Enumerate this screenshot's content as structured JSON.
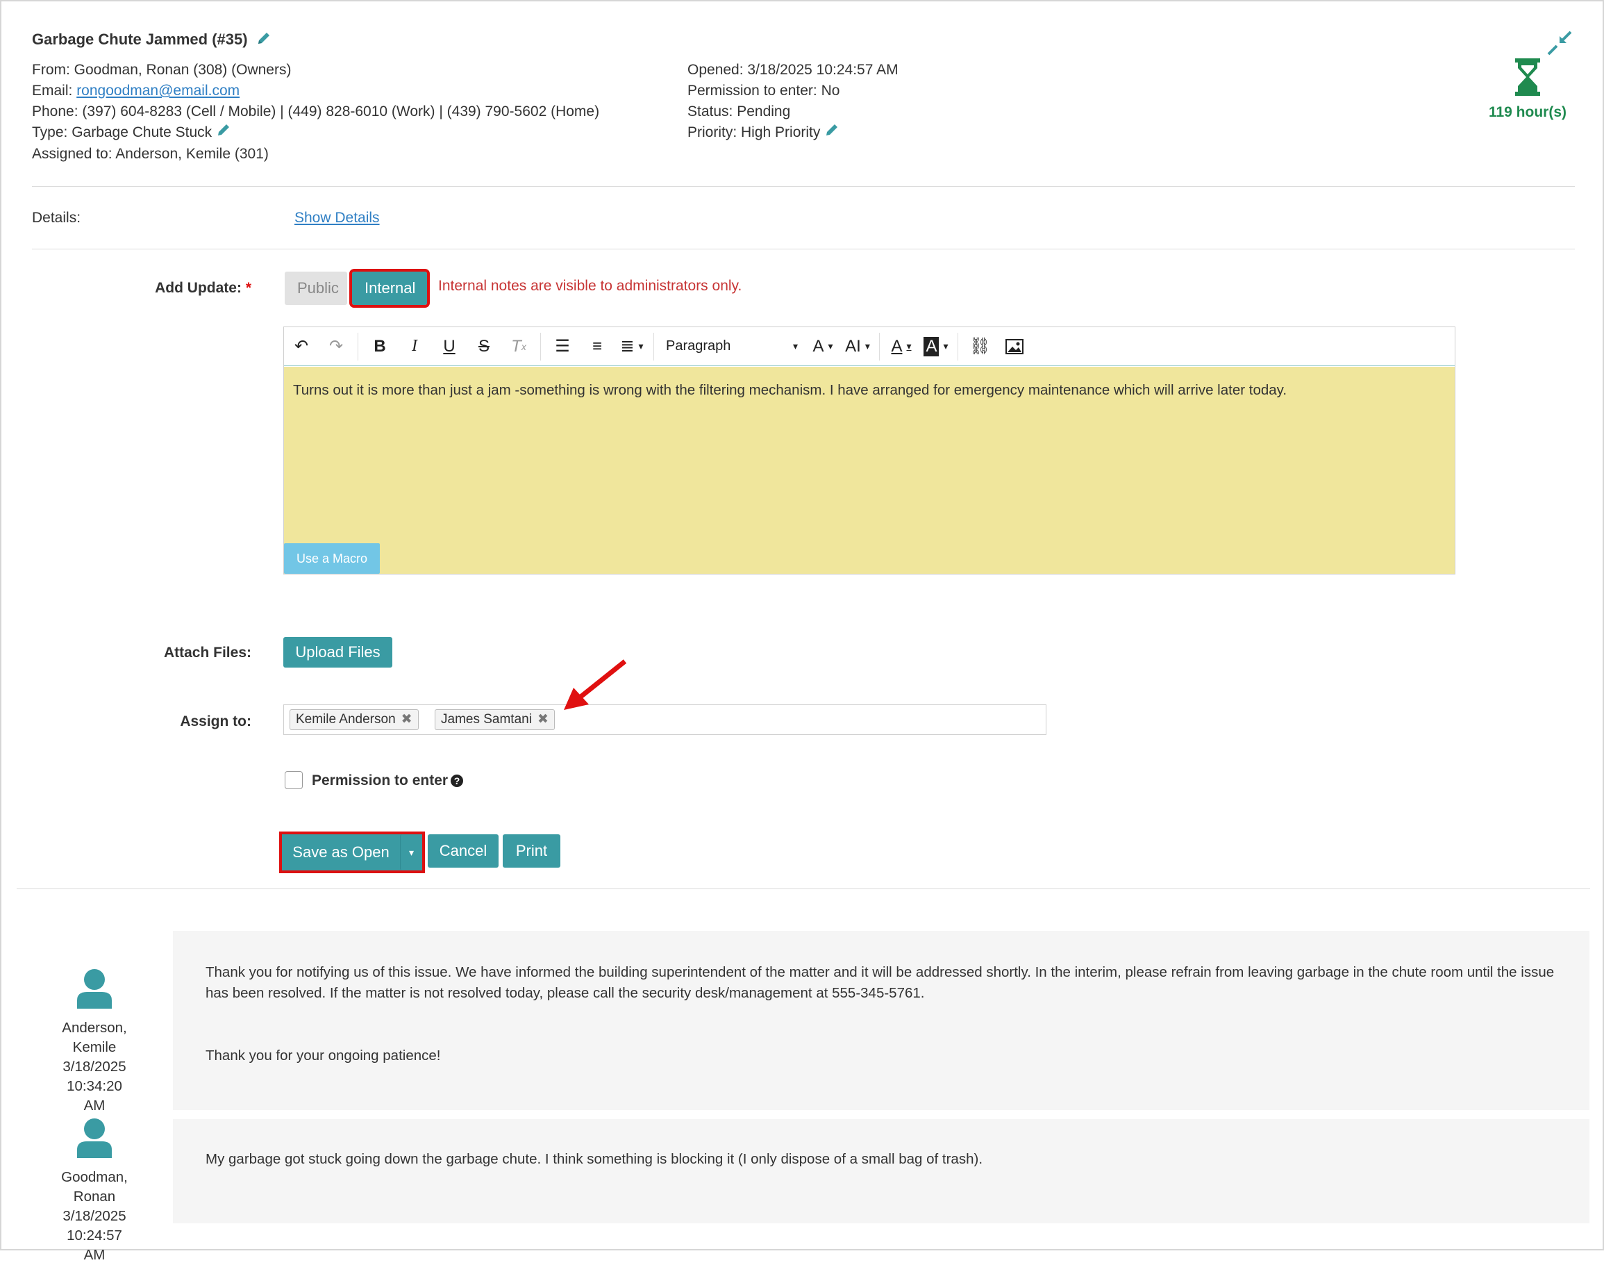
{
  "ticket": {
    "title": "Garbage Chute Jammed (#35)",
    "from": "From: Goodman, Ronan (308) (Owners)",
    "email_label": "Email: ",
    "email": "rongoodman@email.com",
    "phone": "Phone: (397) 604-8283 (Cell / Mobile) | (449) 828-6010 (Work) | (439) 790-5602 (Home)",
    "type": "Type: Garbage Chute Stuck",
    "assigned": "Assigned to: Anderson, Kemile (301)",
    "opened": "Opened: 3/18/2025 10:24:57 AM",
    "permission": "Permission to enter: No",
    "status": "Status: Pending",
    "priority": "Priority: High Priority",
    "timer": "119 hour(s)"
  },
  "details": {
    "label": "Details:",
    "link": "Show Details"
  },
  "update": {
    "label": "Add Update:",
    "required": "*",
    "public": "Public",
    "internal": "Internal",
    "note": "Internal notes are visible to administrators only.",
    "paragraph": "Paragraph",
    "content": "Turns out it is more than just a jam -something is wrong with the filtering mechanism. I have arranged for emergency maintenance which will arrive later today.",
    "macro": "Use a Macro"
  },
  "attach": {
    "label": "Attach Files:",
    "button": "Upload Files"
  },
  "assign": {
    "label": "Assign to:",
    "chips": [
      "Kemile Anderson",
      "James Samtani"
    ]
  },
  "perm": {
    "label": "Permission to enter",
    "checked": false
  },
  "actions": {
    "save": "Save as Open",
    "cancel": "Cancel",
    "print": "Print"
  },
  "comments": [
    {
      "author": "Anderson, Kemile",
      "date": "3/18/2025 10:34:20",
      "time_suffix": "AM",
      "p1": "Thank you for notifying us of this issue. We have informed the building superintendent of the matter and it will be addressed shortly. In the interim, please refrain from leaving garbage in the chute room until the issue has been resolved. If the matter is not resolved today, please call the security desk/management at 555-345-5761.",
      "p2": "Thank you for your ongoing patience!"
    },
    {
      "author": "Goodman, Ronan",
      "date": "3/18/2025 10:24:57",
      "time_suffix": "AM",
      "p1": "My garbage got stuck going down the garbage chute. I think something is blocking it (I only dispose of a small bag of trash)."
    }
  ],
  "colors": {
    "accent": "#3a9ba3",
    "highlight": "#dd1111",
    "editor_bg": "#f0e69c",
    "timer": "#1f8a4f"
  }
}
